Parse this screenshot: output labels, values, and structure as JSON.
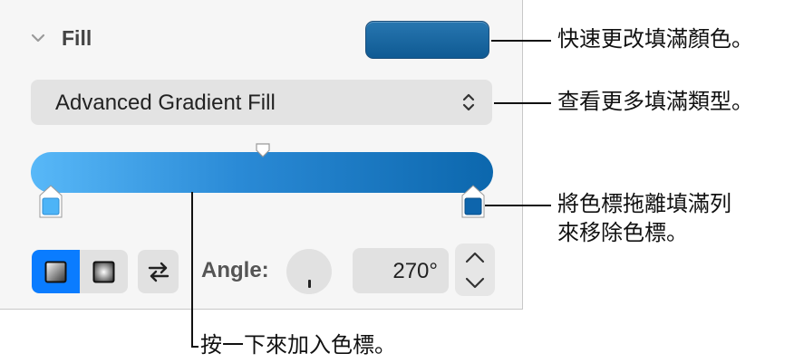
{
  "panel": {
    "section_title": "Fill",
    "fill_type_select": {
      "value": "Advanced Gradient Fill"
    },
    "gradient": {
      "swatch_color": "#1565a3",
      "start_color": "#58b8f8",
      "end_color": "#0c67ad",
      "left_stop_color": "#4db4f7",
      "right_stop_color": "#0e65ac"
    },
    "angle": {
      "label": "Angle:",
      "value": "270°"
    },
    "accent_color": "#0a7cff"
  },
  "callouts": {
    "fill_color": "快速更改填滿顏色。",
    "fill_types": "查看更多填滿類型。",
    "remove_stop_line1": "將色標拖離填滿列",
    "remove_stop_line2": "來移除色標。",
    "add_stop": "按一下來加入色標。"
  },
  "icons": {
    "disclosure": "chevron-down-icon",
    "select": "updown-chevron-icon",
    "swap": "swap-arrows-icon",
    "linear": "linear-gradient-icon",
    "radial": "radial-gradient-icon"
  }
}
